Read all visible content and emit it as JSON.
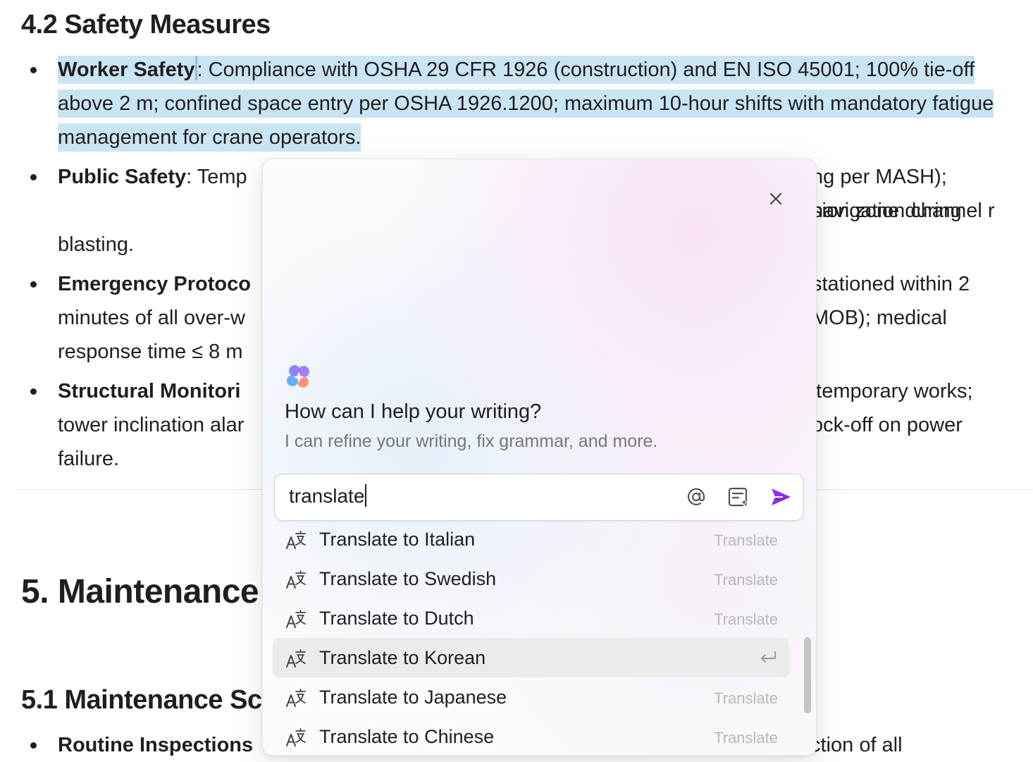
{
  "document": {
    "section_42_title": "4.2 Safety Measures",
    "bullets_42": [
      {
        "label": "Worker Safety",
        "text": ": Compliance with OSHA 29 CFR 1926 (construction) and EN ISO 45001; 100% tie-off above 2 m; confined space entry per OSHA 1926.1200; maximum 10-hour shifts with mandatory fatigue management for crane operators."
      },
      {
        "label": "Public Safety",
        "text_start": ": Temp",
        "text_end": "ng per MASH); navigation channel r",
        "text_right": "sion zone during",
        "text_tail": "blasting."
      },
      {
        "label": "Emergency Protoco",
        "text_right1": "stationed within 2",
        "text_left2": "minutes of all over-w",
        "text_right2": "MOB); medical",
        "text_left3": "response time ≤ 8 m"
      },
      {
        "label": "Structural Monitori",
        "text_right1": "n temporary works;",
        "text_left2": "tower inclination alar",
        "text_right2": "ock-off on power",
        "text_left3": "failure."
      }
    ],
    "section_5_title": "5. Maintenance",
    "section_51_title": "5.1 Maintenance Sc",
    "bullets_51": [
      {
        "label": "Routine Inspections",
        "text_right": "ction of all"
      }
    ]
  },
  "ai_popup": {
    "title": "How can I help your writing?",
    "subtitle": "I can refine your writing, fix grammar, and more.",
    "input_value": "translate",
    "items": [
      {
        "label": "Translate to Italian",
        "hint": "Translate"
      },
      {
        "label": "Translate to Swedish",
        "hint": "Translate"
      },
      {
        "label": "Translate to Dutch",
        "hint": "Translate"
      },
      {
        "label": "Translate to Korean",
        "hint": "",
        "active": true
      },
      {
        "label": "Translate to Japanese",
        "hint": "Translate"
      },
      {
        "label": "Translate to Chinese",
        "hint": "Translate"
      }
    ],
    "colors": {
      "send": "#8a2be2",
      "selection": "#c9e4f2",
      "active_item": "#ebebeb"
    }
  }
}
